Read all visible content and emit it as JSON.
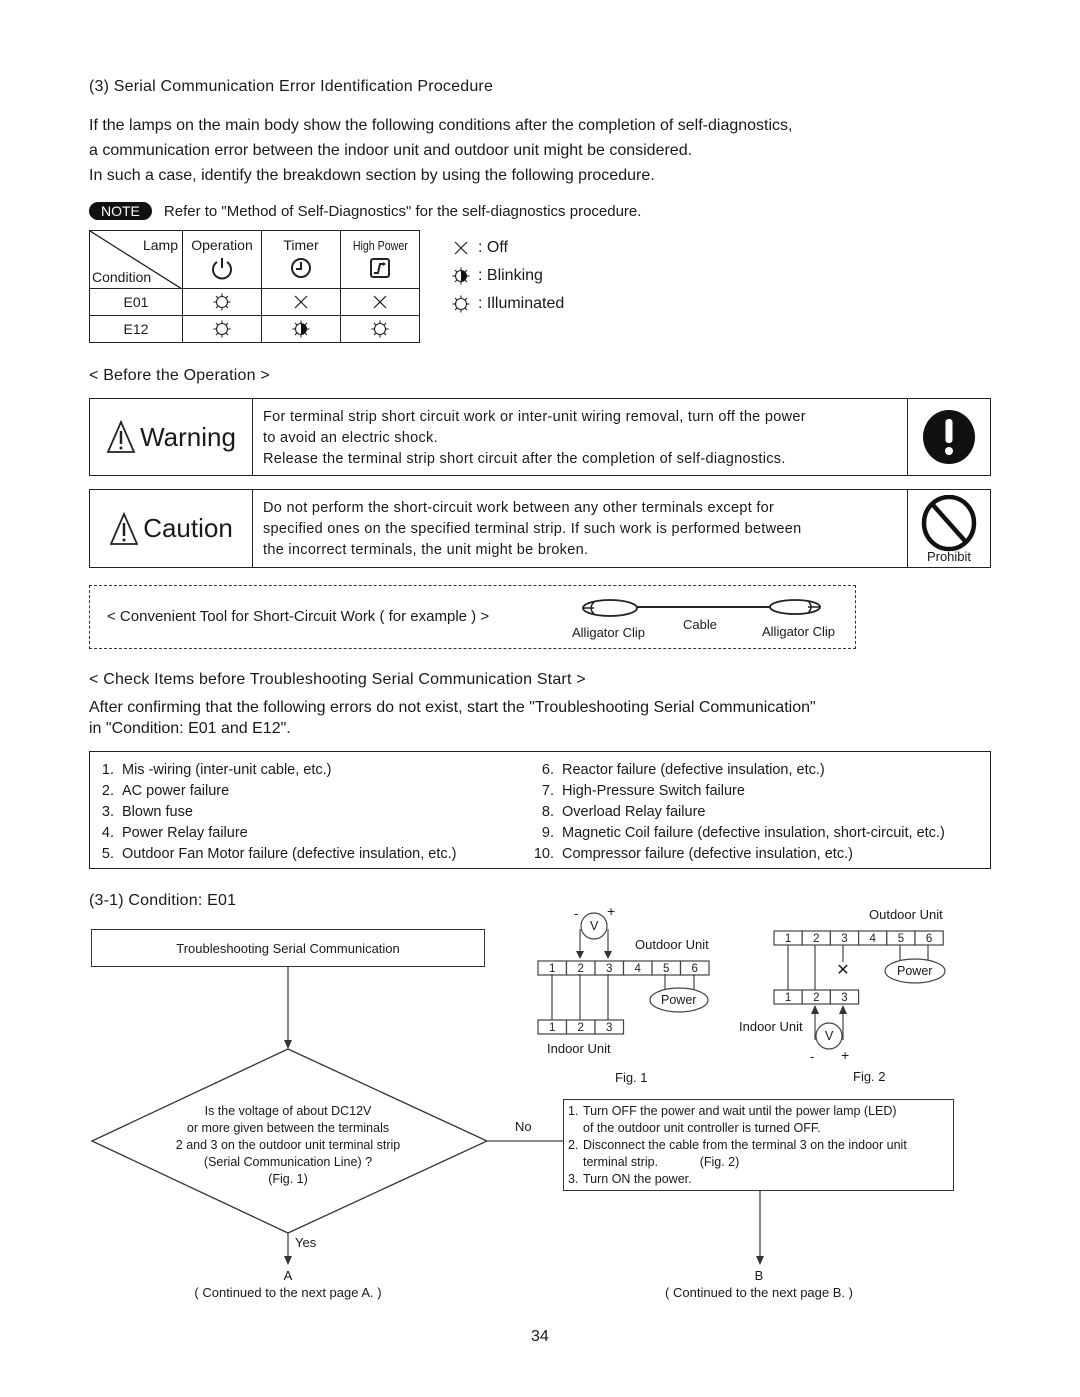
{
  "section": {
    "title": "(3) Serial Communication Error Identification Procedure",
    "intro": [
      "If the lamps on the main body show the following conditions after the completion of self-diagnostics,",
      "a communication error between the indoor unit and outdoor unit might be considered.",
      "In such a case, identify the breakdown section by using the following procedure."
    ],
    "note_badge": "NOTE",
    "note_text": "Refer to \"Method of Self-Diagnostics\" for the self-diagnostics procedure."
  },
  "lamp_table": {
    "corner_top": "Lamp",
    "corner_bottom": "Condition",
    "columns": [
      {
        "label": "Operation",
        "icon": "power-icon"
      },
      {
        "label": "Timer",
        "icon": "clock-icon"
      },
      {
        "label": "High Power",
        "icon": "high-power-icon"
      }
    ],
    "rows": [
      {
        "condition": "E01",
        "states": [
          "illuminated",
          "off",
          "off"
        ]
      },
      {
        "condition": "E12",
        "states": [
          "illuminated",
          "blinking",
          "illuminated"
        ]
      }
    ]
  },
  "legend": [
    {
      "symbol": "off",
      "label": ": Off"
    },
    {
      "symbol": "blinking",
      "label": ": Blinking"
    },
    {
      "symbol": "illuminated",
      "label": ": Illuminated"
    }
  ],
  "before_operation": {
    "heading": "< Before the Operation >",
    "warning": {
      "title": "Warning",
      "lines": [
        "For terminal strip short circuit work or inter-unit wiring removal, turn off the power",
        "to avoid an electric shock.",
        "Release the terminal strip short circuit after the completion of self-diagnostics."
      ]
    },
    "caution": {
      "title": "Caution",
      "lines": [
        "Do not perform the short-circuit work between any other terminals except for",
        "specified ones on the specified terminal strip. If such work is performed between",
        "the incorrect terminals, the unit might be broken."
      ],
      "icon_label": "Prohibit"
    }
  },
  "tool": {
    "text": "< Convenient Tool for Short-Circuit Work ( for example ) >",
    "left_clip": "Alligator Clip",
    "cable": "Cable",
    "right_clip": "Alligator Clip"
  },
  "check_items": {
    "heading": "< Check Items before Troubleshooting Serial Communication Start >",
    "intro": [
      "After confirming that the following errors do not exist, start the \"Troubleshooting Serial Communication\"",
      "in \"Condition: E01 and E12\"."
    ],
    "left": [
      {
        "num": "1.",
        "text": "Mis -wiring (inter-unit cable, etc.)"
      },
      {
        "num": "2.",
        "text": "AC power failure"
      },
      {
        "num": "3.",
        "text": "Blown fuse"
      },
      {
        "num": "4.",
        "text": "Power Relay failure"
      },
      {
        "num": "5.",
        "text": "Outdoor Fan Motor failure (defective insulation, etc.)"
      }
    ],
    "right": [
      {
        "num": "6.",
        "text": "Reactor failure (defective insulation, etc.)"
      },
      {
        "num": "7.",
        "text": "High-Pressure Switch failure"
      },
      {
        "num": "8.",
        "text": "Overload Relay failure"
      },
      {
        "num": "9.",
        "text": "Magnetic Coil failure (defective insulation, short-circuit, etc.)"
      },
      {
        "num": "10.",
        "text": "Compressor failure (defective insulation, etc.)"
      }
    ]
  },
  "condition_e01": {
    "heading": "(3-1) Condition: E01",
    "start_box": "Troubleshooting Serial Communication",
    "decision": [
      "Is the voltage of about DC12V",
      "or more given between the terminals",
      "2 and 3 on the outdoor unit terminal strip",
      "(Serial Communication Line) ?",
      "(Fig. 1)"
    ],
    "yes_label": "Yes",
    "no_label": "No",
    "action_box": [
      {
        "num": "1.",
        "text": "Turn OFF the power and wait until the power lamp (LED)",
        "cont": "of the outdoor unit controller is turned OFF."
      },
      {
        "num": "2.",
        "text": "Disconnect the cable from the terminal 3 on the indoor unit",
        "cont": "terminal strip.            (Fig. 2)"
      },
      {
        "num": "3.",
        "text": "Turn ON the power.",
        "cont": ""
      }
    ],
    "connector_a": "A",
    "connector_a_text": "( Continued to the next page A. )",
    "connector_b": "B",
    "connector_b_text": "( Continued to the next page B. )"
  },
  "fig1": {
    "caption": "Fig. 1",
    "outdoor_label": "Outdoor Unit",
    "indoor_label": "Indoor Unit",
    "outdoor_terminals": [
      "1",
      "2",
      "3",
      "4",
      "5",
      "6"
    ],
    "indoor_terminals": [
      "1",
      "2",
      "3"
    ],
    "power": "Power",
    "meter": "V",
    "minus": "-",
    "plus": "+"
  },
  "fig2": {
    "caption": "Fig. 2",
    "outdoor_label": "Outdoor Unit",
    "indoor_label": "Indoor Unit",
    "outdoor_terminals": [
      "1",
      "2",
      "3",
      "4",
      "5",
      "6"
    ],
    "indoor_terminals": [
      "1",
      "2",
      "3"
    ],
    "power": "Power",
    "meter": "V",
    "minus": "-",
    "plus": "+"
  },
  "page_number": "34"
}
